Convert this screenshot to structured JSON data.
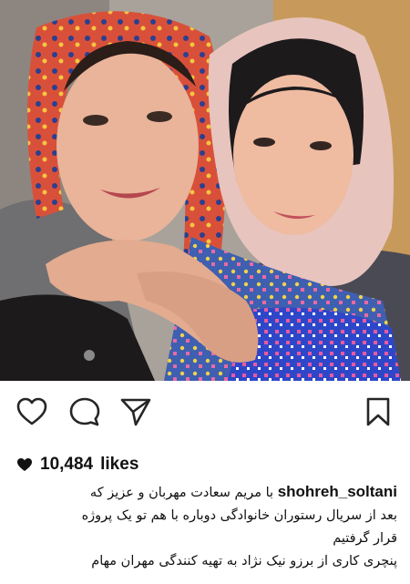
{
  "post": {
    "image_alt": "Selfie of two women wearing headscarves, one embracing the other",
    "likes_count": "10,484",
    "likes_suffix": "likes",
    "username": "shohreh_soltani",
    "caption_line1": "با مریم سعادت  مهربان و عزیز که",
    "caption_line2": "بعد از سریال رستوران خانوادگی دوباره با هم تو یک پروژه",
    "caption_line3": "قرار گرفتیم",
    "caption_line4": "پنچری کاری از برزو نیک نژاد به تهیه کنندگی مهران مهام"
  },
  "icons": {
    "like": "heart-outline-icon",
    "comment": "speech-bubble-icon",
    "share": "paper-plane-icon",
    "save": "bookmark-icon",
    "likes_heart": "heart-filled-icon"
  },
  "colors": {
    "text": "#111111",
    "background": "#ffffff",
    "icon": "#262626"
  }
}
